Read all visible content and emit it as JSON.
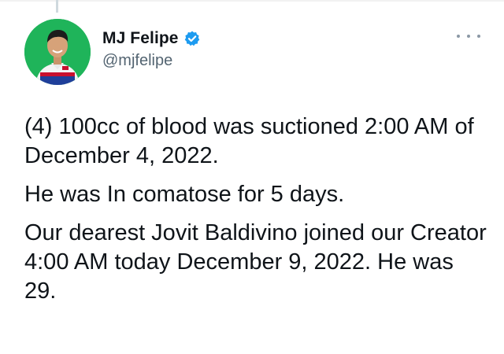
{
  "author": {
    "display_name": "MJ Felipe",
    "handle": "@mjfelipe",
    "verified_icon": "verified-badge-icon",
    "avatar_icon": "profile-photo"
  },
  "tweet": {
    "paragraphs": [
      "(4) 100cc of blood was suctioned 2:00 AM of December 4, 2022.",
      "He was In comatose for 5 days.",
      "Our dearest Jovit Baldivino joined our Creator 4:00 AM today December 9, 2022. He was 29."
    ]
  },
  "menu": {
    "icon": "more-options-icon"
  },
  "colors": {
    "text": "#0f1419",
    "secondary_text": "#536471",
    "verified_blue": "#1d9bf0",
    "avatar_background": "#1fb45a"
  }
}
